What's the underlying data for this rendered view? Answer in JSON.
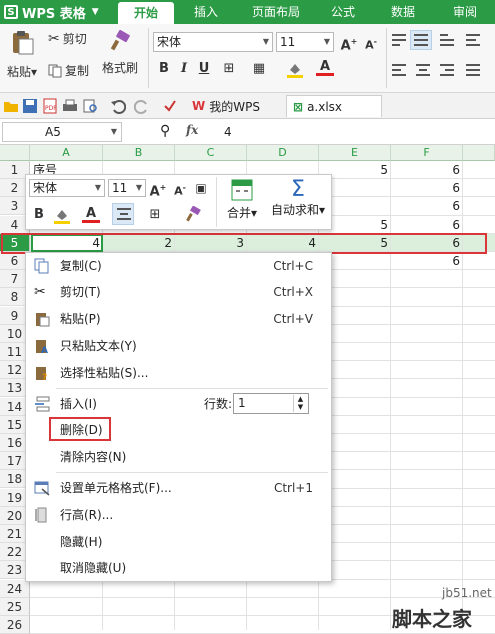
{
  "app": {
    "name": "WPS 表格"
  },
  "ribbon_tabs": [
    "开始",
    "插入",
    "页面布局",
    "公式",
    "数据",
    "审阅"
  ],
  "ribbon": {
    "paste": "粘贴",
    "cut": "剪切",
    "copy": "复制",
    "format_painter": "格式刷",
    "font_name": "宋体",
    "font_size": "11"
  },
  "quick_bar": {
    "tab_mywps": "我的WPS",
    "tab_file": "a.xlsx"
  },
  "formula_bar": {
    "cell_ref": "A5",
    "fx": "fx",
    "value": "4"
  },
  "columns": [
    "A",
    "B",
    "C",
    "D",
    "E",
    "F"
  ],
  "rows": [
    "1",
    "2",
    "3",
    "4",
    "5",
    "6",
    "7",
    "8",
    "9",
    "10",
    "11",
    "12",
    "13",
    "14",
    "15",
    "16",
    "17",
    "18",
    "19",
    "20",
    "21",
    "22",
    "23",
    "24",
    "25",
    "26"
  ],
  "cells": {
    "A1": "序号",
    "E1": "5",
    "F1": "6",
    "F2": "6",
    "F3": "6",
    "E4": "5",
    "F4": "6",
    "A5": "4",
    "B5": "2",
    "C5": "3",
    "D5": "4",
    "E5": "5",
    "F5": "6",
    "F6": "6"
  },
  "mini_toolbar": {
    "font_name": "宋体",
    "font_size": "11",
    "merge": "合并",
    "autosum": "自动求和"
  },
  "context_menu": {
    "items": [
      {
        "label": "复制(C)",
        "shortcut": "Ctrl+C",
        "icon": "copy-icon"
      },
      {
        "label": "剪切(T)",
        "shortcut": "Ctrl+X",
        "icon": "scissors-icon"
      },
      {
        "label": "粘贴(P)",
        "shortcut": "Ctrl+V",
        "icon": "paste-icon"
      },
      {
        "label": "只粘贴文本(Y)",
        "shortcut": "",
        "icon": "paste-text-icon"
      },
      {
        "label": "选择性粘贴(S)...",
        "shortcut": "",
        "icon": "paste-special-icon"
      },
      {
        "label": "插入(I)",
        "shortcut": "",
        "icon": "insert-row-icon"
      },
      {
        "label": "删除(D)",
        "shortcut": "",
        "icon": ""
      },
      {
        "label": "清除内容(N)",
        "shortcut": "",
        "icon": ""
      },
      {
        "label": "设置单元格格式(F)...",
        "shortcut": "Ctrl+1",
        "icon": "format-cells-icon"
      },
      {
        "label": "行高(R)...",
        "shortcut": "",
        "icon": "row-height-icon"
      },
      {
        "label": "隐藏(H)",
        "shortcut": "",
        "icon": ""
      },
      {
        "label": "取消隐藏(U)",
        "shortcut": "",
        "icon": ""
      }
    ],
    "rows_label": "行数:",
    "rows_value": "1"
  },
  "watermark": {
    "site": "jb51.net",
    "name": "脚本之家"
  },
  "colors": {
    "brand": "#2b9b45",
    "highlight": "#d9363a"
  }
}
